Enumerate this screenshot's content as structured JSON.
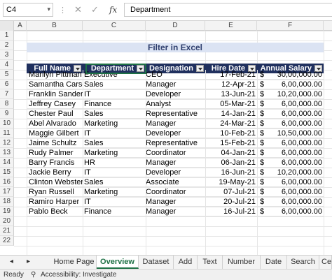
{
  "formula_bar": {
    "name_box": "C4",
    "cancel_glyph": "✕",
    "enter_glyph": "✓",
    "fx_label": "fx",
    "content": "Department"
  },
  "columns": [
    "A",
    "B",
    "C",
    "D",
    "E",
    "F"
  ],
  "rows": [
    "1",
    "2",
    "3",
    "4",
    "5",
    "6",
    "7",
    "8",
    "9",
    "10",
    "11",
    "12",
    "13",
    "14",
    "15",
    "16",
    "17",
    "18",
    "19",
    "20",
    "21",
    "22"
  ],
  "sheet": {
    "title": "Filter in Excel",
    "headers": [
      "Full Name",
      "Department",
      "Designation",
      "Hire Date",
      "Annual Salary"
    ],
    "currency_symbol": "$",
    "records": [
      {
        "name": "Marilyn Pittman",
        "dept": "Executive",
        "desig": "CEO",
        "date": "17-Feb-21",
        "salary": "30,00,000.00"
      },
      {
        "name": "Samantha Carson",
        "dept": "Sales",
        "desig": "Manager",
        "date": "12-Apr-21",
        "salary": "6,00,000.00"
      },
      {
        "name": "Franklin Sanders",
        "dept": "IT",
        "desig": "Developer",
        "date": "13-Jun-21",
        "salary": "10,20,000.00"
      },
      {
        "name": "Jeffrey Casey",
        "dept": "Finance",
        "desig": "Analyst",
        "date": "05-Mar-21",
        "salary": "6,00,000.00"
      },
      {
        "name": "Chester Paul",
        "dept": "Sales",
        "desig": "Representative",
        "date": "14-Jan-21",
        "salary": "6,00,000.00"
      },
      {
        "name": "Abel Alvarado",
        "dept": "Marketing",
        "desig": "Manager",
        "date": "24-Mar-21",
        "salary": "6,00,000.00"
      },
      {
        "name": "Maggie Gilbert",
        "dept": "IT",
        "desig": "Developer",
        "date": "10-Feb-21",
        "salary": "10,50,000.00"
      },
      {
        "name": "Jaime Schultz",
        "dept": "Sales",
        "desig": "Representative",
        "date": "15-Feb-21",
        "salary": "6,00,000.00"
      },
      {
        "name": "Rudy Palmer",
        "dept": "Marketing",
        "desig": "Coordinator",
        "date": "04-Jan-21",
        "salary": "6,00,000.00"
      },
      {
        "name": "Barry Francis",
        "dept": "HR",
        "desig": "Manager",
        "date": "06-Jan-21",
        "salary": "6,00,000.00"
      },
      {
        "name": "Jackie Berry",
        "dept": "IT",
        "desig": "Developer",
        "date": "16-Jun-21",
        "salary": "10,20,000.00"
      },
      {
        "name": "Clinton Webster",
        "dept": "Sales",
        "desig": "Associate",
        "date": "19-May-21",
        "salary": "6,00,000.00"
      },
      {
        "name": "Ryan Russell",
        "dept": "Marketing",
        "desig": "Coordinator",
        "date": "07-Jul-21",
        "salary": "6,00,000.00"
      },
      {
        "name": "Ramiro Harper",
        "dept": "IT",
        "desig": "Manager",
        "date": "20-Jul-21",
        "salary": "6,00,000.00"
      },
      {
        "name": "Pablo Beck",
        "dept": "Finance",
        "desig": "Manager",
        "date": "16-Jul-21",
        "salary": "6,00,000.00"
      }
    ]
  },
  "tabs": {
    "nav_prev": "◂",
    "nav_next": "▸",
    "items": [
      "Home Page",
      "Overview",
      "Dataset",
      "Add",
      "Text",
      "Number",
      "Date",
      "Search",
      "Ce"
    ],
    "active_index": 1
  },
  "status": {
    "ready": "Ready",
    "accessibility": "Accessibility: Investigate"
  },
  "colors": {
    "header_fill": "#20305e",
    "title_fill": "#dbe3f3",
    "accent_green": "#1e7145"
  }
}
